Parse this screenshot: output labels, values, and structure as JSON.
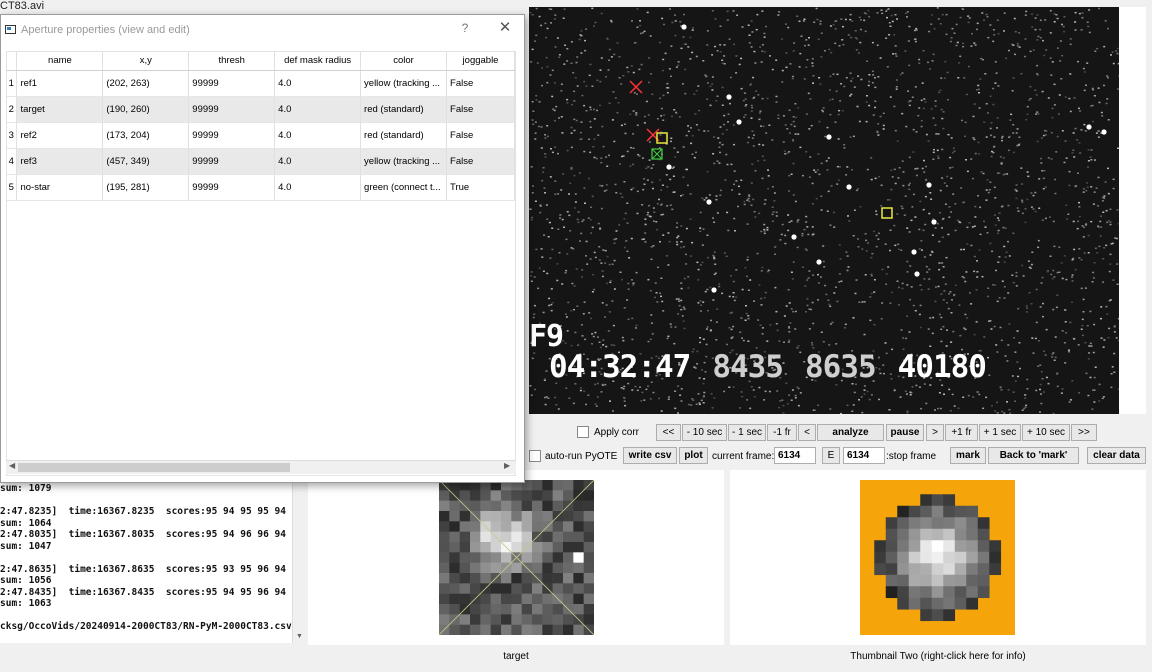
{
  "main_title_fragment": "CT83.avi",
  "dialog": {
    "title": "Aperture properties (view and edit)",
    "help_label": "?",
    "close_label": "✕",
    "columns": [
      "name",
      "x,y",
      "thresh",
      "def mask radius",
      "color",
      "joggable"
    ],
    "rows": [
      {
        "num": "1",
        "name": "ref1",
        "xy": "(202, 263)",
        "thresh": "99999",
        "radius": "4.0",
        "color": "yellow (tracking ...",
        "joggable": "False"
      },
      {
        "num": "2",
        "name": "target",
        "xy": "(190, 260)",
        "thresh": "99999",
        "radius": "4.0",
        "color": "red (standard)",
        "joggable": "False"
      },
      {
        "num": "3",
        "name": "ref2",
        "xy": "(173, 204)",
        "thresh": "99999",
        "radius": "4.0",
        "color": "red (standard)",
        "joggable": "False"
      },
      {
        "num": "4",
        "name": "ref3",
        "xy": "(457, 349)",
        "thresh": "99999",
        "radius": "4.0",
        "color": "yellow (tracking ...",
        "joggable": "False"
      },
      {
        "num": "5",
        "name": "no-star",
        "xy": "(195, 281)",
        "thresh": "99999",
        "radius": "4.0",
        "color": "green (connect t...",
        "joggable": "True"
      }
    ]
  },
  "video": {
    "frame_label": "F9",
    "time": "04:32:47",
    "code1": "8435",
    "code2": "8635",
    "code3": "40180"
  },
  "controls": {
    "apply_corr": "Apply corr",
    "nav": [
      "<<",
      "- 10 sec",
      "- 1 sec",
      "-1 fr",
      "<",
      "analyze",
      "pause",
      ">",
      "+1 fr",
      "+ 1 sec",
      "+ 10 sec",
      ">>"
    ],
    "auto_run": "auto-run PyOTE",
    "write_csv": "write csv",
    "plot": "plot",
    "current_frame_label": "current frame:",
    "current_frame_value": "6134",
    "e_label": "E",
    "stop_frame_value": "6134",
    "stop_frame_label": ":stop frame",
    "mark": "mark",
    "back_to_mark": "Back to 'mark'",
    "clear_data": "clear data"
  },
  "log_lines": [
    "sum: 1079",
    "",
    "2:47.8235]  time:16367.8235  scores:95 94 95 95 94",
    "sum: 1064",
    "2:47.8035]  time:16367.8035  scores:95 94 96 96 94",
    "sum: 1047",
    "",
    "2:47.8635]  time:16367.8635  scores:95 93 95 96 94",
    "sum: 1056",
    "2:47.8435]  time:16367.8435  scores:95 94 95 96 94",
    "sum: 1063",
    "",
    "cksg/OccoVids/20240914-2000CT83/RN-PyM-2000CT83.csv"
  ],
  "thumbnails": {
    "one_label": "target",
    "two_label": "Thumbnail Two (right-click here for info)",
    "two_background": "#f5a40a"
  },
  "icons": {
    "dialog_icon": "window-icon",
    "close": "close-icon",
    "help": "help-icon"
  }
}
